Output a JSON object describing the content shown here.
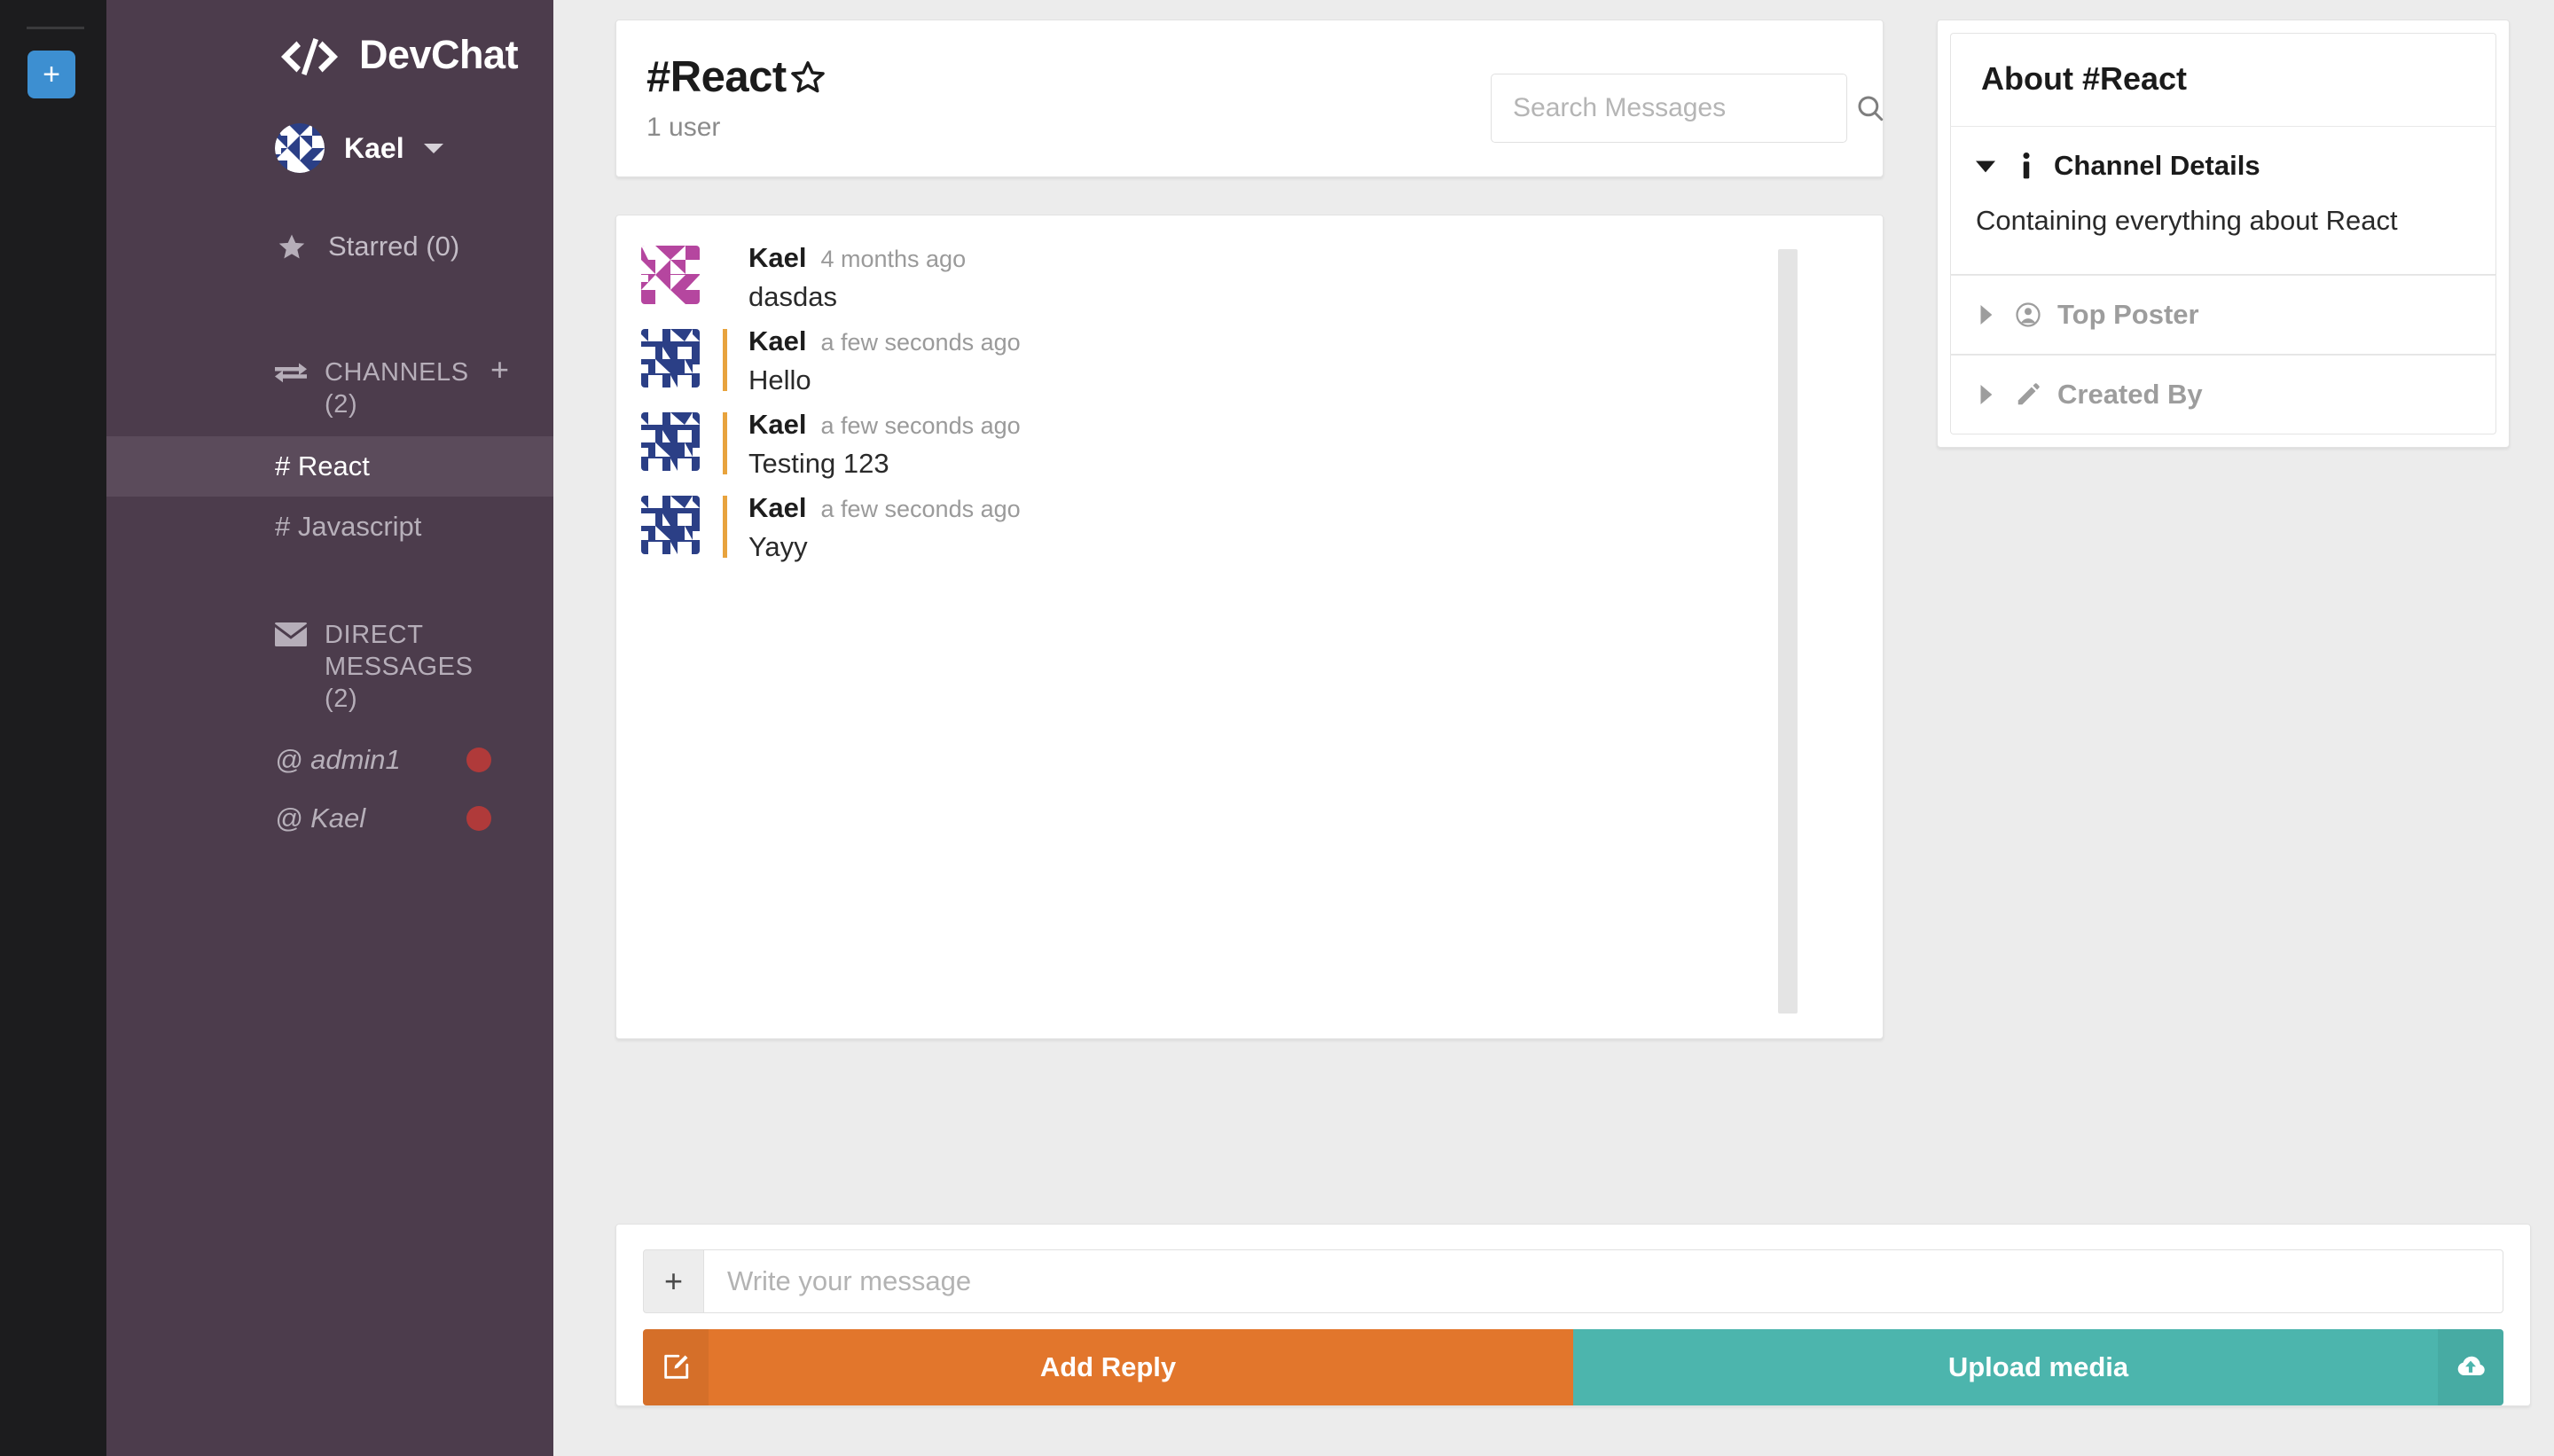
{
  "rail": {
    "add_workspace_label": "+"
  },
  "sidebar": {
    "brand": "DevChat",
    "logo_icon": "code-brackets-icon",
    "current_user": "Kael",
    "starred": {
      "icon": "star-icon",
      "label": "Starred (0)"
    },
    "channels_section": {
      "icon": "exchange-arrows-icon",
      "title": "CHANNELS (2)",
      "add_label": "+",
      "items": [
        {
          "label": "# React",
          "active": true
        },
        {
          "label": "# Javascript",
          "active": false
        }
      ]
    },
    "dm_section": {
      "icon": "envelope-icon",
      "title": "DIRECT MESSAGES (2)",
      "items": [
        {
          "label": "@ admin1",
          "status": "offline"
        },
        {
          "label": "@ Kael",
          "status": "offline"
        }
      ]
    }
  },
  "channel_header": {
    "title": "#React",
    "star_icon": "star-outline-icon",
    "user_count": "1 user",
    "search": {
      "placeholder": "Search Messages",
      "value": "",
      "icon": "search-icon"
    }
  },
  "messages": [
    {
      "author": "Kael",
      "time": "4 months ago",
      "text": "dasdas",
      "avatar_color": "#b5469f",
      "is_reply": false
    },
    {
      "author": "Kael",
      "time": "a few seconds ago",
      "text": "Hello",
      "avatar_color": "#2b3f86",
      "is_reply": true
    },
    {
      "author": "Kael",
      "time": "a few seconds ago",
      "text": "Testing 123",
      "avatar_color": "#2b3f86",
      "is_reply": true
    },
    {
      "author": "Kael",
      "time": "a few seconds ago",
      "text": "Yayy",
      "avatar_color": "#2b3f86",
      "is_reply": true
    }
  ],
  "about_panel": {
    "title": "About #React",
    "sections": [
      {
        "label": "Channel Details",
        "icon": "info-icon",
        "expanded": true,
        "body": "Containing everything about React"
      },
      {
        "label": "Top Poster",
        "icon": "user-circle-icon",
        "expanded": false,
        "body": ""
      },
      {
        "label": "Created By",
        "icon": "pencil-icon",
        "expanded": false,
        "body": ""
      }
    ]
  },
  "composer": {
    "plus_label": "+",
    "placeholder": "Write your message",
    "value": "",
    "add_reply_label": "Add Reply",
    "add_reply_icon": "compose-icon",
    "upload_label": "Upload media",
    "upload_icon": "cloud-upload-icon"
  },
  "colors": {
    "rail_bg": "#1c1c1e",
    "sidebar_bg": "#4c3c4c",
    "sidebar_active": "#5b4b5b",
    "accent_blue": "#3d8fd1",
    "reply_accent": "#e8a33d",
    "add_reply_bg": "#e2762c",
    "upload_bg": "#4cb5ad",
    "offline_dot": "#b03a3a",
    "page_bg": "#ececec"
  }
}
